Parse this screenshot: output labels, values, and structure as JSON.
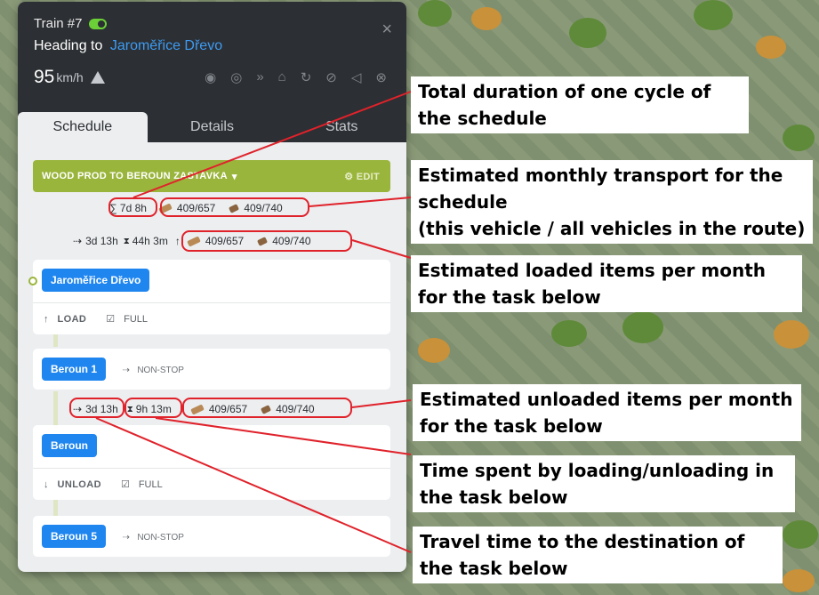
{
  "header": {
    "title": "Train #7",
    "heading_prefix": "Heading to",
    "destination": "Jaroměřice Dřevo",
    "speed": "95",
    "speed_unit": "km/h",
    "icons": [
      "target-icon",
      "eye-icon",
      "skip-icon",
      "depot-icon",
      "refresh-icon",
      "no-shop-icon",
      "horn-icon",
      "mute-icon"
    ]
  },
  "tabs": [
    "Schedule",
    "Details",
    "Stats"
  ],
  "schedule": {
    "name": "WOOD PROD TO BEROUN ZASTAVKA",
    "edit_label": "EDIT",
    "cycle_duration": "∑ 7d 8h",
    "monthly_this": "409/657",
    "monthly_all": "409/740"
  },
  "leg1": {
    "travel": "3d 13h",
    "loading": "44h 3m",
    "arrow": "↑",
    "this": "409/657",
    "all": "409/740"
  },
  "task1": {
    "station": "Jaroměřice Dřevo",
    "action": "LOAD",
    "condition": "FULL"
  },
  "task2": {
    "station": "Beroun 1",
    "mode": "NON-STOP"
  },
  "leg2": {
    "travel": "3d 13h",
    "loading": "9h 13m",
    "arrow": "↓",
    "this": "409/657",
    "all": "409/740"
  },
  "task3": {
    "station": "Beroun",
    "action": "UNLOAD",
    "condition": "FULL"
  },
  "task4": {
    "station": "Beroun 5",
    "mode": "NON-STOP"
  },
  "annotations": {
    "total_duration": "Total duration of one cycle of the schedule",
    "monthly_transport_1": "Estimated monthly transport for the schedule",
    "monthly_transport_2": "(this vehicle / all vehicles in the route)",
    "loaded_items": "Estimated loaded items per month for the task below",
    "unloaded_items": "Estimated unloaded items per month for the task below",
    "loading_time": "Time spent by loading/unloading in the task below",
    "travel_time": "Travel time to the destination of the task below"
  },
  "colors": {
    "accent_green": "#9ab53b",
    "chip_blue": "#1f86f0",
    "link_blue": "#3d9bf2",
    "annotation_red": "#e0222b",
    "header_dark": "#2c2f33"
  }
}
